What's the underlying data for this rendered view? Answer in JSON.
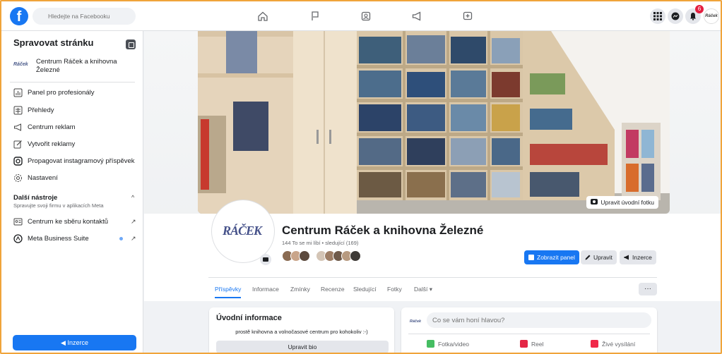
{
  "topbar": {
    "logo": "f",
    "search_placeholder": "Hledejte na Facebooku",
    "notifications_count": "6",
    "profile_label": "Ráček"
  },
  "sidebar": {
    "title": "Spravovat stránku",
    "page_logo": "Ráček",
    "page_name": "Centrum Ráček a knihovna Železné",
    "items": [
      {
        "label": "Panel pro profesionály",
        "icon": "dashboard-icon"
      },
      {
        "label": "Přehledy",
        "icon": "insights-icon"
      },
      {
        "label": "Centrum reklam",
        "icon": "megaphone-icon"
      },
      {
        "label": "Vytvořit reklamy",
        "icon": "pencil-icon"
      },
      {
        "label": "Propagovat instagramový příspěvek",
        "icon": "instagram-icon"
      },
      {
        "label": "Nastavení",
        "icon": "gear-icon"
      }
    ],
    "tools_title": "Další nástroje",
    "tools_subtitle": "Spravujte svoji firmu v aplikacích Meta",
    "tools": [
      {
        "label": "Centrum ke sběru kontaktů",
        "icon": "contacts-icon"
      },
      {
        "label": "Meta Business Suite",
        "icon": "meta-icon"
      }
    ],
    "cta_label": "Inzerce"
  },
  "cover": {
    "edit_label": "Upravit úvodní fotku"
  },
  "page": {
    "avatar_text": "RÁČEK",
    "name": "Centrum Ráček a knihovna Železné",
    "stats": "144 To se mi líbí • sledující (169)",
    "buttons": {
      "dashboard": "Zobrazit panel",
      "edit": "Upravit",
      "ads": "Inzerce"
    },
    "tabs": [
      "Příspěvky",
      "Informace",
      "Zmínky",
      "Recenze",
      "Sledující",
      "Fotky",
      "Další ▾"
    ],
    "more": "···"
  },
  "intro": {
    "title": "Úvodní informace",
    "text": "prostě knihovna a volnočasové centrum pro kohokoliv :-)",
    "button": "Upravit bio"
  },
  "composer": {
    "placeholder": "Co se vám honí hlavou?",
    "actions": [
      {
        "label": "Fotka/video",
        "color": "#45bd62"
      },
      {
        "label": "Reel",
        "color": "#e42645"
      },
      {
        "label": "Živé vysílání",
        "color": "#f02849"
      }
    ]
  },
  "colors": {
    "accent": "#1877f2",
    "frame": "#f0a43a"
  }
}
